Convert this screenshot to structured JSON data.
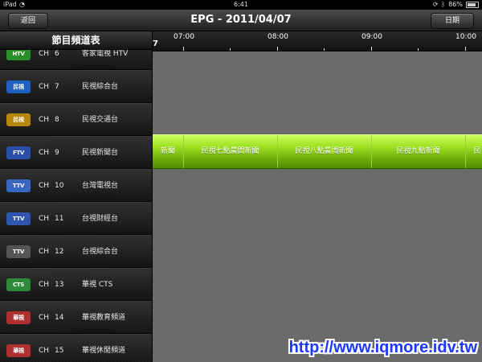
{
  "status_bar": {
    "carrier": "iPad",
    "time": "6:41",
    "battery": "86%"
  },
  "header": {
    "title": "EPG - 2011/04/07",
    "back_label": "返回",
    "date_label": "日期"
  },
  "sidebar": {
    "title": "節目頻道表"
  },
  "channels": [
    {
      "prefix": "CH",
      "number": "6",
      "name": "客家電視 HTV",
      "logo_text": "HTV",
      "logo_color": "#2a8f2a"
    },
    {
      "prefix": "CH",
      "number": "7",
      "name": "民視綜合台",
      "logo_text": "民視",
      "logo_color": "#1f5fbf"
    },
    {
      "prefix": "CH",
      "number": "8",
      "name": "民視交通台",
      "logo_text": "民視",
      "logo_color": "#b8860b"
    },
    {
      "prefix": "CH",
      "number": "9",
      "name": "民視新聞台",
      "logo_text": "FTV",
      "logo_color": "#2b4fa8"
    },
    {
      "prefix": "CH",
      "number": "10",
      "name": "台灣電視台",
      "logo_text": "TTV",
      "logo_color": "#3a66c4"
    },
    {
      "prefix": "CH",
      "number": "11",
      "name": "台視財經台",
      "logo_text": "TTV",
      "logo_color": "#2f55b0"
    },
    {
      "prefix": "CH",
      "number": "12",
      "name": "台視綜合台",
      "logo_text": "TTV",
      "logo_color": "#555555"
    },
    {
      "prefix": "CH",
      "number": "13",
      "name": "華視 CTS",
      "logo_text": "CTS",
      "logo_color": "#2c8a3a"
    },
    {
      "prefix": "CH",
      "number": "14",
      "name": "華視教育頻道",
      "logo_text": "華視",
      "logo_color": "#b03030"
    },
    {
      "prefix": "CH",
      "number": "15",
      "name": "華視休閒頻道",
      "logo_text": "華視",
      "logo_color": "#b03030"
    }
  ],
  "timeline": {
    "cut_digit": "7",
    "labels": [
      "07:00",
      "08:00",
      "09:00",
      "10:00"
    ]
  },
  "programs": [
    "新聞",
    "民視七點晨間新聞",
    "民視八點晨間新聞",
    "民視九點新聞",
    "民"
  ],
  "watermark": "http://www.iqmore.idv.tw",
  "colors": {
    "highlight_row": "#8fd11a",
    "grid_background": "#6b6b6b",
    "watermark": "#1a38ff"
  }
}
